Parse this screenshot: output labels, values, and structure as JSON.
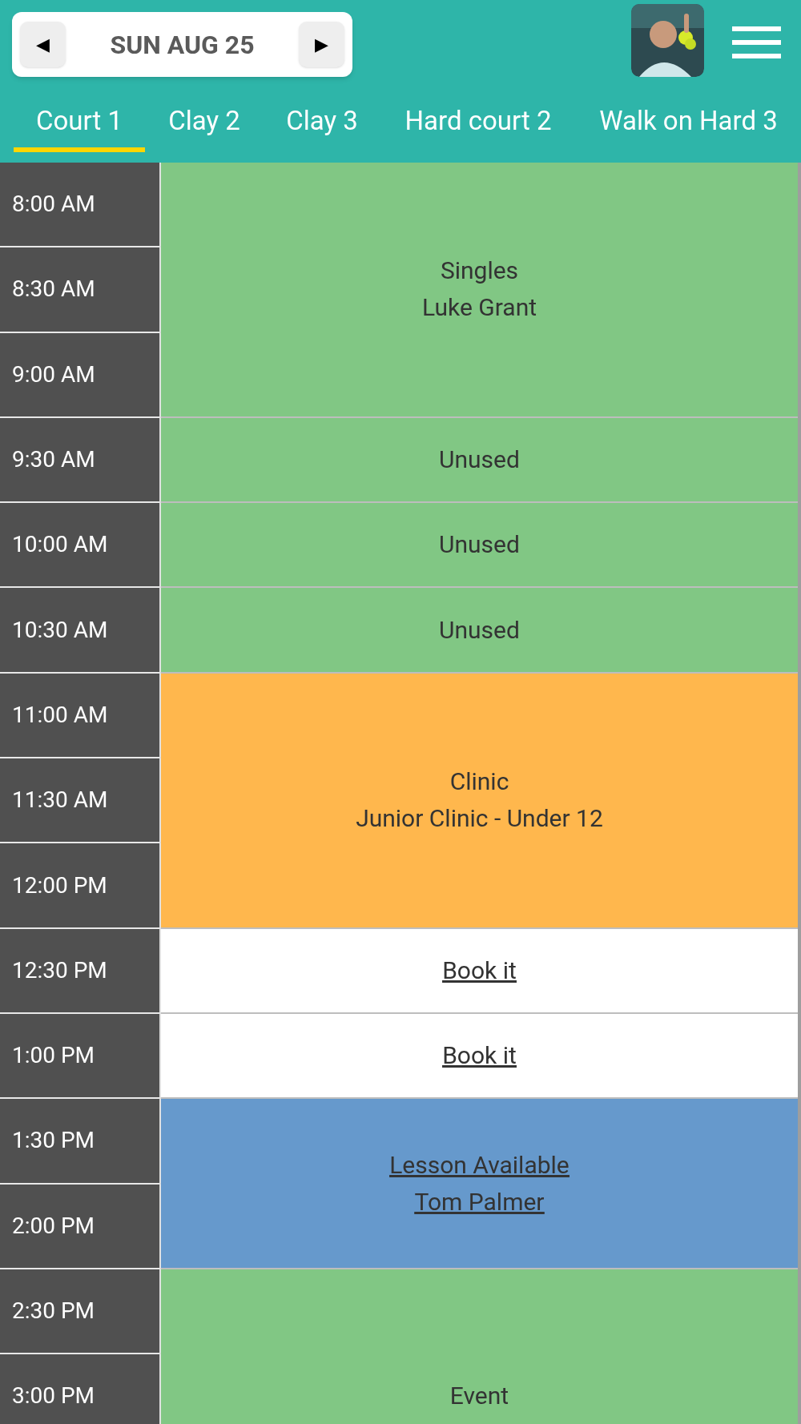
{
  "header": {
    "date": "SUN AUG 25",
    "prev_button": "◀",
    "next_button": "▶"
  },
  "tabs": [
    {
      "label": "Court 1",
      "selected": true
    },
    {
      "label": "Clay 2",
      "selected": false
    },
    {
      "label": "Clay 3",
      "selected": false
    },
    {
      "label": "Hard court 2",
      "selected": false
    },
    {
      "label": "Walk on Hard 3",
      "selected": false
    }
  ],
  "blocks": [
    {
      "kind": "booking",
      "color": "#81c784",
      "times": [
        "8:00 AM",
        "8:30 AM",
        "9:00 AM"
      ],
      "lines": [
        "Singles",
        "Luke Grant"
      ]
    },
    {
      "kind": "booking",
      "color": "#81c784",
      "times": [
        "9:30 AM"
      ],
      "lines": [
        "Unused"
      ]
    },
    {
      "kind": "booking",
      "color": "#81c784",
      "times": [
        "10:00 AM"
      ],
      "lines": [
        "Unused"
      ]
    },
    {
      "kind": "booking",
      "color": "#81c784",
      "times": [
        "10:30 AM"
      ],
      "lines": [
        "Unused"
      ]
    },
    {
      "kind": "booking",
      "color": "#ffb74d",
      "times": [
        "11:00 AM",
        "11:30 AM",
        "12:00 PM"
      ],
      "lines": [
        "Clinic",
        "Junior Clinic - Under 12"
      ]
    },
    {
      "kind": "open",
      "color": "#ffffff",
      "times": [
        "12:30 PM"
      ],
      "lines": [
        "Book it"
      ]
    },
    {
      "kind": "open",
      "color": "#ffffff",
      "times": [
        "1:00 PM"
      ],
      "lines": [
        "Book it"
      ]
    },
    {
      "kind": "lesson",
      "color": "#6699cc",
      "times": [
        "1:30 PM",
        "2:00 PM"
      ],
      "lines": [
        "Lesson Available",
        "Tom Palmer"
      ]
    },
    {
      "kind": "booking",
      "color": "#81c784",
      "times": [
        "2:30 PM",
        "3:00 PM"
      ],
      "lines": [
        "Event"
      ],
      "continues": true
    }
  ]
}
